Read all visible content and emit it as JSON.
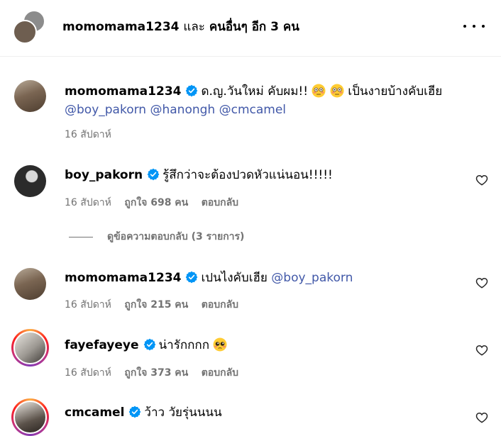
{
  "header": {
    "username": "momomama1234",
    "and_text": "และ",
    "others_text": "คนอื่นๆ อีก 3 คน"
  },
  "caption": {
    "username": "momomama1234",
    "text": "ด.ญ.วันใหม่ คับผม!!",
    "text2": "เป็นงายบ้างคับเฮีย",
    "mentions": [
      "@boy_pakorn",
      "@hanongh",
      "@cmcamel"
    ],
    "time": "16 สัปดาห์"
  },
  "comments": [
    {
      "username": "boy_pakorn",
      "text": "รู้สึกว่าจะต้องปวดหัวแน่นอน!!!!!",
      "time": "16 สัปดาห์",
      "likes": "ถูกใจ 698 คน",
      "reply": "ตอบกลับ"
    },
    {
      "username": "momomama1234",
      "text": "เปนไงคับเฮีย",
      "mention": "@boy_pakorn",
      "time": "16 สัปดาห์",
      "likes": "ถูกใจ 215 คน",
      "reply": "ตอบกลับ"
    },
    {
      "username": "fayefayeye",
      "text": "น่ารักกกก",
      "time": "16 สัปดาห์",
      "likes": "ถูกใจ 373 คน",
      "reply": "ตอบกลับ"
    },
    {
      "username": "cmcamel",
      "text": "ว้าว วัยรุ่นนนน"
    }
  ],
  "view_replies": "ดูข้อความตอบกลับ (3 รายการ)",
  "icons": {
    "verified": "verified-badge-icon",
    "heart": "heart-outline-icon",
    "more": "more-horizontal-icon"
  },
  "colors": {
    "verified": "#0095f6",
    "mention": "#4158a8",
    "secondary": "#737373"
  }
}
